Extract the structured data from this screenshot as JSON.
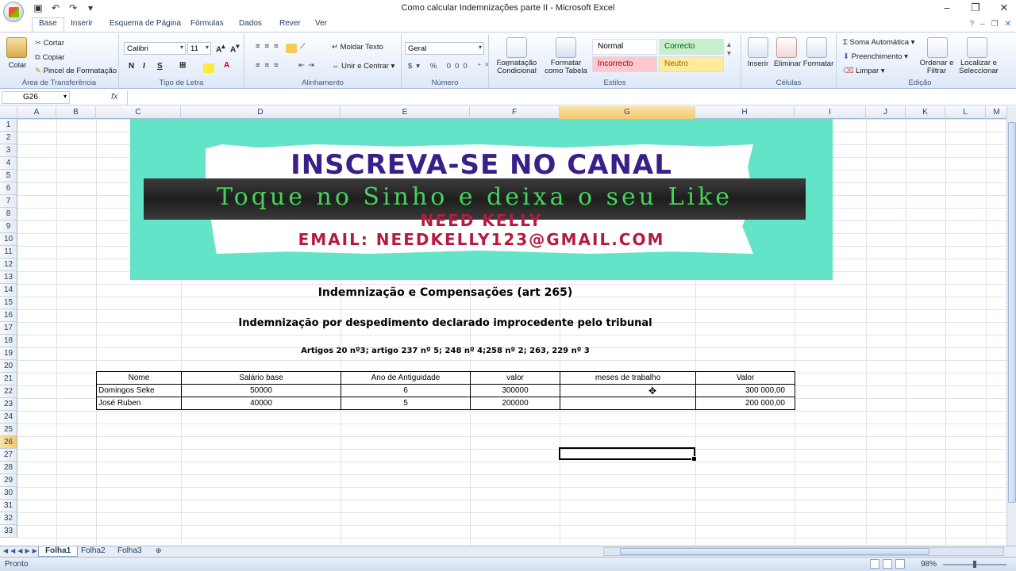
{
  "window": {
    "title": "Como calcular Indemnizações parte II - Microsoft Excel"
  },
  "ribbon": {
    "tabs": [
      "Base",
      "Inserir",
      "Esquema de Página",
      "Fórmulas",
      "Dados",
      "Rever",
      "Ver"
    ],
    "clipboard": {
      "paste": "Colar",
      "cut": "Cortar",
      "copy": "Copiar",
      "format_painter": "Pincel de Formatação",
      "label": "Área de Transferência"
    },
    "font": {
      "name": "Calibri",
      "size": "11",
      "label": "Tipo de Letra"
    },
    "alignment": {
      "wrap": "Moldar Texto",
      "merge": "Unir e Centrar",
      "label": "Alinhamento"
    },
    "number": {
      "format": "Geral",
      "label": "Número"
    },
    "styles": {
      "conditional": "Formatação Condicional",
      "as_table": "Formatar como Tabela",
      "normal": "Normal",
      "good": "Correcto",
      "bad": "Incorrecto",
      "neutral": "Neutro",
      "label": "Estilos"
    },
    "cells": {
      "insert": "Inserir",
      "delete": "Eliminar",
      "format": "Formatar",
      "label": "Células"
    },
    "editing": {
      "autosum": "Soma Automática",
      "fill": "Preenchimento",
      "clear": "Limpar",
      "sort": "Ordenar e Filtrar",
      "find": "Localizar e Seleccionar",
      "label": "Edição"
    }
  },
  "formula_bar": {
    "cell_ref": "G26",
    "fx": "fx",
    "value": ""
  },
  "columns": [
    "A",
    "B",
    "C",
    "D",
    "E",
    "F",
    "G",
    "H",
    "I",
    "J",
    "K",
    "L",
    "M"
  ],
  "rows": [
    "1",
    "2",
    "3",
    "4",
    "5",
    "6",
    "7",
    "8",
    "9",
    "10",
    "11",
    "12",
    "13",
    "14",
    "15",
    "16",
    "17",
    "18",
    "19",
    "20",
    "21",
    "22",
    "23",
    "24",
    "25",
    "26",
    "27",
    "28",
    "29",
    "30",
    "31",
    "32",
    "33"
  ],
  "banner": {
    "line1": "INSCREVA-SE NO CANAL",
    "line2": "Toque no Sinho e deixa o seu Like",
    "line3": "NEED KELLY",
    "line4": "EMAIL: NEEDKELLY123@GMAIL.COM"
  },
  "sheet": {
    "heading": "Indemnização e Compensações (art 265)",
    "subheading": "Indemnização  por despedimento declarado improcedente pelo tribunal",
    "articles": "Artigos 20 nº3; artigo 237 nº 5; 248 nº 4;258 nº 2; 263, 229 nº 3",
    "table": {
      "headers": [
        "Nome",
        "Salário base",
        "Ano de Antiguidade",
        "valor",
        "meses de trabalho",
        "Valor"
      ],
      "rows": [
        [
          "Domingos Seke",
          "50000",
          "6",
          "300000",
          "",
          "300 000,00"
        ],
        [
          "José Ruben",
          "40000",
          "5",
          "200000",
          "",
          "200 000,00"
        ]
      ]
    }
  },
  "sheet_tabs": [
    "Folha1",
    "Folha2",
    "Folha3"
  ],
  "status": {
    "text": "Pronto",
    "zoom": "98%"
  }
}
